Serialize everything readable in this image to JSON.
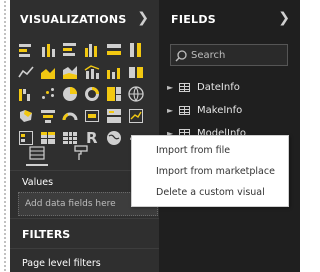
{
  "visualizations": {
    "title": "VISUALIZATIONS",
    "tiles": [
      "stacked-bar-chart-icon",
      "stacked-column-chart-icon",
      "clustered-bar-chart-icon",
      "clustered-column-chart-icon",
      "100-stacked-bar-chart-icon",
      "100-stacked-column-chart-icon",
      "line-chart-icon",
      "area-chart-icon",
      "stacked-area-chart-icon",
      "line-and-stacked-column-chart-icon",
      "line-and-clustered-column-chart-icon",
      "ribbon-chart-icon",
      "waterfall-chart-icon",
      "scatter-chart-icon",
      "pie-chart-icon",
      "donut-chart-icon",
      "treemap-icon",
      "map-icon",
      "filled-map-icon",
      "funnel-icon",
      "gauge-icon",
      "card-icon",
      "multi-row-card-icon",
      "kpi-icon",
      "slicer-icon",
      "table-icon",
      "matrix-icon",
      "r-visual-icon",
      "globe-visual-icon",
      "more-options-icon"
    ],
    "r_label": "R",
    "more_label": "···",
    "values_label": "Values",
    "values_placeholder": "Add data fields here"
  },
  "filters": {
    "title": "FILTERS",
    "page_level_label": "Page level filters"
  },
  "fields": {
    "title": "FIELDS",
    "search_placeholder": "Search",
    "tables": [
      "DateInfo",
      "MakeInfo",
      "ModelInfo"
    ]
  },
  "context_menu": {
    "items": [
      "Import from file",
      "Import from marketplace",
      "Delete a custom visual"
    ]
  },
  "colors": {
    "viz_pane_bg": "#2f2f2f",
    "fields_pane_bg": "#1f1f1f",
    "accent_yellow": "#f2c811",
    "tile_grey": "#cfcfcf"
  }
}
